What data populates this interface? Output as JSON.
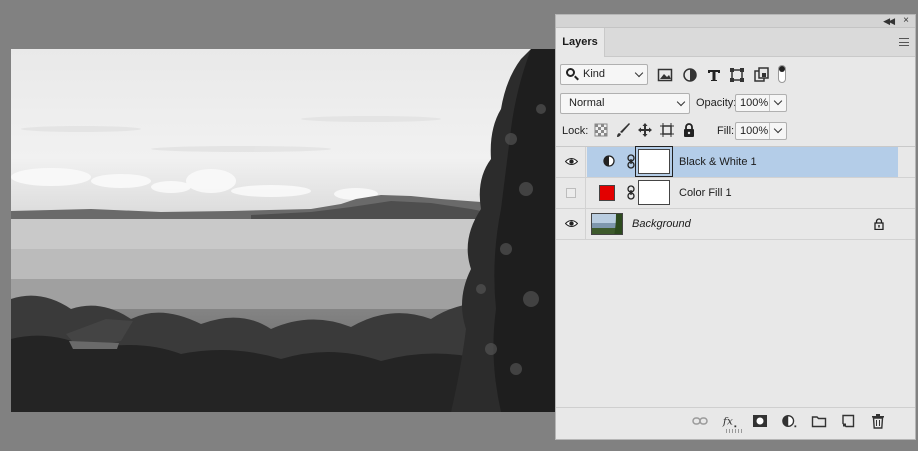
{
  "canvas": {
    "description_icon": "canvas-document"
  },
  "panel": {
    "tab_label": "Layers",
    "filter": {
      "kind_label": "Kind"
    },
    "blend_mode": "Normal",
    "opacity_label": "Opacity:",
    "opacity_value": "100%",
    "lock_label": "Lock:",
    "fill_label": "Fill:",
    "fill_value": "100%",
    "layers": [
      {
        "name": "Black & White 1",
        "visible": true,
        "selected": true,
        "type": "adjustment"
      },
      {
        "name": "Color Fill 1",
        "visible": false,
        "selected": false,
        "type": "fill",
        "color": "#e30000"
      },
      {
        "name": "Background",
        "visible": true,
        "selected": false,
        "type": "image",
        "locked": true
      }
    ],
    "bottom_icons": [
      "link-icon",
      "fx-icon",
      "mask-icon",
      "adjustment-icon",
      "folder-icon",
      "new-layer-icon",
      "trash-icon"
    ]
  },
  "colors": {
    "selection": "#b4cde8",
    "panel_bg": "#e8e8e8",
    "workspace_bg": "#818181"
  }
}
